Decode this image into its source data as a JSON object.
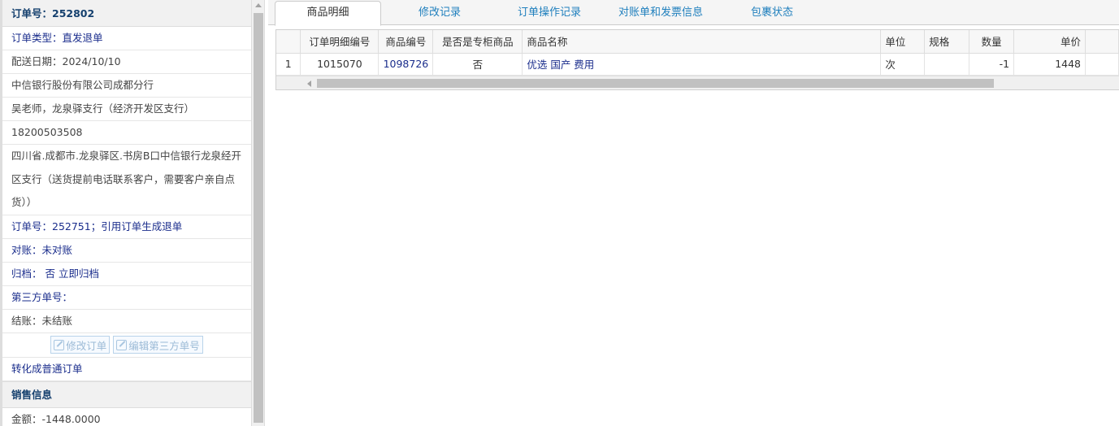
{
  "left": {
    "order_no": "订单号：252802",
    "order_type": "订单类型：直发退单",
    "delivery_date": "配送日期：2024/10/10",
    "company": "中信银行股份有限公司成都分行",
    "contact": "吴老师，龙泉驿支行（经济开发区支行）",
    "phone": "18200503508",
    "address": "四川省.成都市.龙泉驿区.书房B口中信银行龙泉经开区支行（送货提前电话联系客户，需要客户亲自点货））",
    "ref_order": "订单号：252751；引用订单生成退单",
    "reconcile": "对账：未对账",
    "archive": "归档： 否 立即归档",
    "third_party": "第三方单号：",
    "settle": "结账：未结账",
    "btn_edit_order": "修改订单",
    "btn_edit_third": "编辑第三方单号",
    "convert": "转化成普通订单",
    "sales_info": "销售信息",
    "amount": "金额：-1448.0000"
  },
  "tabs": [
    "商品明细",
    "修改记录",
    "订单操作记录",
    "对账单和发票信息",
    "包裹状态"
  ],
  "table": {
    "columns": [
      "",
      "订单明细编号",
      "商品编号",
      "是否是专柜商品",
      "商品名称",
      "单位",
      "规格",
      "数量",
      "单价"
    ],
    "rows": [
      [
        "1",
        "1015070",
        "1098726",
        "否",
        "优选 国产 费用",
        "次",
        "",
        "-1",
        "1448"
      ]
    ]
  }
}
